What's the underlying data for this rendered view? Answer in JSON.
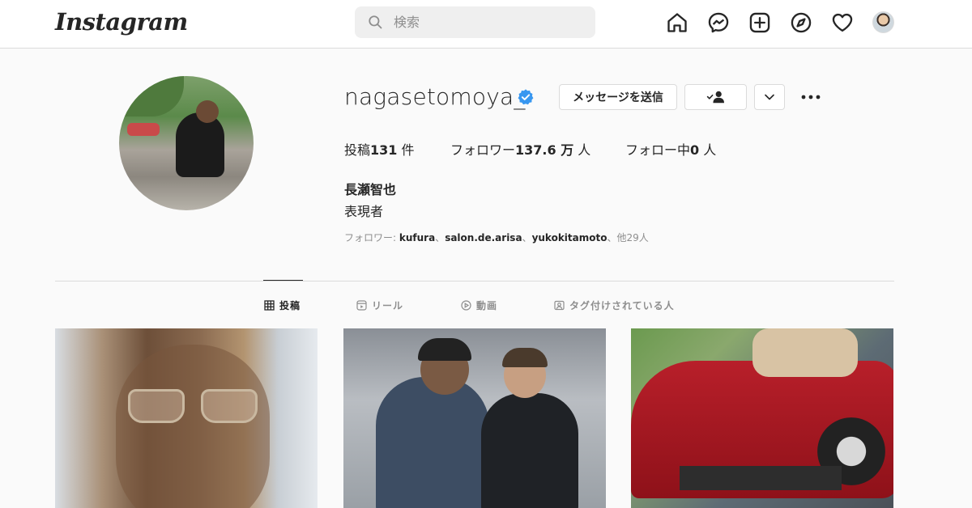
{
  "nav": {
    "logo": "Instagram",
    "search_placeholder": "検索",
    "icons": [
      "home-icon",
      "messenger-icon",
      "new-post-icon",
      "explore-icon",
      "activity-heart-icon",
      "profile-avatar"
    ]
  },
  "profile": {
    "username": "nagasetomoya_",
    "verified": true,
    "buttons": {
      "message": "メッセージを送信",
      "following_icon": "person-check-icon",
      "more_dropdown_icon": "chevron-down-icon",
      "options_icon": "more-horizontal-icon"
    },
    "stats": {
      "posts_label": "投稿",
      "posts_value": "131",
      "posts_unit": "件",
      "followers_label": "フォロワー",
      "followers_value": "137.6 万",
      "followers_unit": "人",
      "following_label": "フォロー中",
      "following_value": "0",
      "following_unit": "人"
    },
    "full_name": "長瀬智也",
    "bio": "表現者",
    "followed_by": {
      "prefix": "フォロワー: ",
      "names": [
        "kufura",
        "salon.de.arisa",
        "yukokitamoto"
      ],
      "separator": "、",
      "suffix": "他29人"
    }
  },
  "tabs": [
    {
      "label": "投稿",
      "icon": "grid-icon",
      "active": true
    },
    {
      "label": "リール",
      "icon": "reels-icon",
      "active": false
    },
    {
      "label": "動画",
      "icon": "video-play-icon",
      "active": false
    },
    {
      "label": "タグ付けされている人",
      "icon": "tagged-icon",
      "active": false
    }
  ],
  "colors": {
    "background": "#fafafa",
    "nav_background": "#ffffff",
    "border": "#dbdbdb",
    "text": "#262626",
    "muted": "#8e8e8e",
    "verified_blue": "#3897f0",
    "search_bg": "#efefef"
  }
}
